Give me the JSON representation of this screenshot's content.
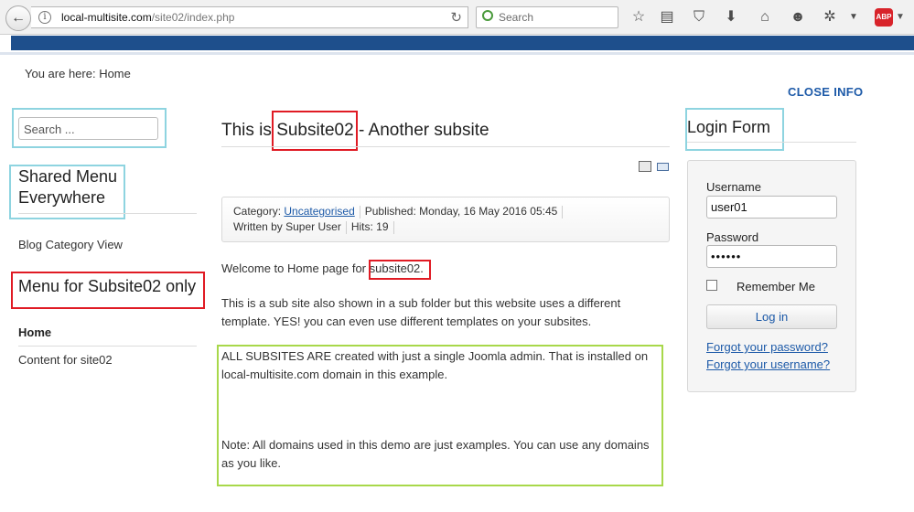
{
  "browser": {
    "url_domain": "local-multisite.com",
    "url_path": "/site02/index.php",
    "search_placeholder": "Search",
    "info_glyph": "i",
    "reload_glyph": "↻",
    "back_glyph": "←",
    "abp_label": "ABP",
    "icons": [
      "star-icon",
      "reading-list-icon",
      "pocket-icon",
      "download-icon",
      "home-icon",
      "emoji-icon",
      "extension-icon",
      "menu-dropdown-icon",
      "adblock-plus-icon"
    ]
  },
  "breadcrumb": "You are here: Home",
  "close_info": "CLOSE INFO",
  "left": {
    "search_placeholder": "Search ...",
    "shared_menu_title": "Shared Menu Everywhere",
    "shared_menu_items": [
      "Blog Category View"
    ],
    "subsite_menu_title": "Menu for Subsite02 only",
    "subsite_menu_items": [
      "Home",
      "Content for site02"
    ]
  },
  "article": {
    "title_prefix": "This is ",
    "title_highlight": "Subsite02",
    "title_suffix": " - Another subsite",
    "category_label": "Category: ",
    "category_link": "Uncategorised",
    "published": "Published: Monday, 16 May 2016 05:45",
    "author": "Written by Super User",
    "hits": "Hits: 19",
    "welcome_prefix": "Welcome to Home page for ",
    "welcome_highlight": "subsite02.",
    "para1": "This is a sub site also shown in a sub folder but this website uses a different template. YES! you can even use different templates on your subsites.",
    "para2": "ALL SUBSITES ARE created with just a single Joomla admin. That is installed on local-multisite.com domain in this example.",
    "para3": "Note: All domains used in this demo are just examples. You can use any domains as you like."
  },
  "login": {
    "title": "Login Form",
    "username_label": "Username",
    "username_value": "user01",
    "password_label": "Password",
    "password_value": "••••••",
    "remember_label": "Remember Me",
    "login_button": "Log in",
    "forgot_password": "Forgot your password?",
    "forgot_username": "Forgot your username?"
  },
  "colors": {
    "banner": "#1e4f8c",
    "link": "#1d5aa8",
    "highlight_cyan": "#8ed4e0",
    "highlight_red": "#e01b24",
    "highlight_green": "#a8d84a"
  }
}
